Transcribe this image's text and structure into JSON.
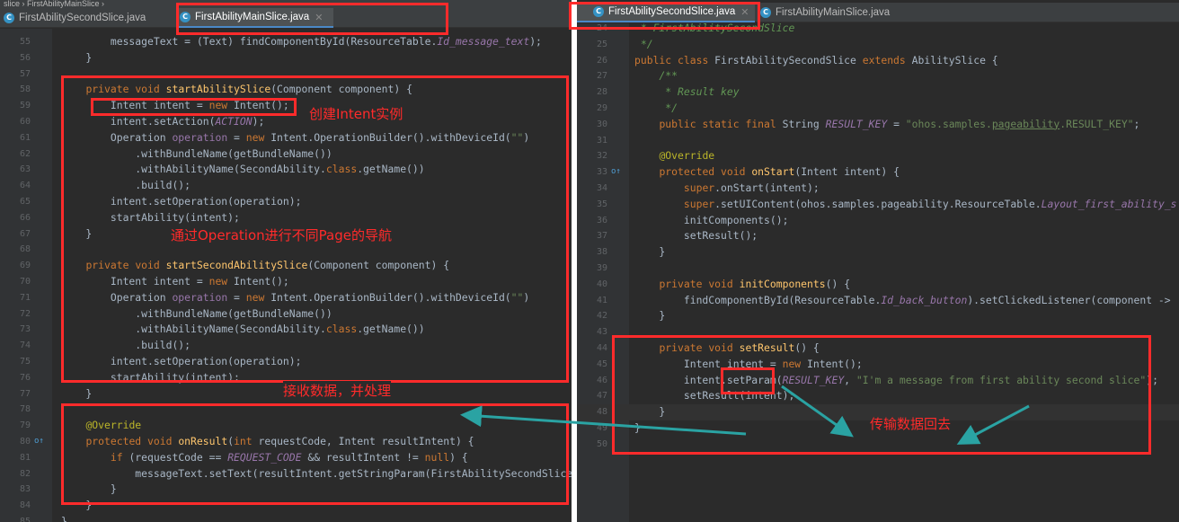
{
  "left_editor": {
    "breadcrumb": "slice › FirstAbilityMainSlice ›",
    "tabs": [
      {
        "label": "FirstAbilitySecondSlice.java",
        "icon": "C"
      },
      {
        "label": "FirstAbilityMainSlice.java",
        "icon": "C",
        "active": true
      }
    ],
    "lines": [
      {
        "n": "55",
        "code": "        messageText = (Text) findComponentById(ResourceTable.Id_message_text);"
      },
      {
        "n": "56",
        "code": "    }"
      },
      {
        "n": "57",
        "code": ""
      },
      {
        "n": "58",
        "code": "    private void startAbilitySlice(Component component) {"
      },
      {
        "n": "59",
        "code": "        Intent intent = new Intent();"
      },
      {
        "n": "60",
        "code": "        intent.setAction(ACTION);"
      },
      {
        "n": "61",
        "code": "        Operation operation = new Intent.OperationBuilder().withDeviceId(\"\")"
      },
      {
        "n": "62",
        "code": "            .withBundleName(getBundleName())"
      },
      {
        "n": "63",
        "code": "            .withAbilityName(SecondAbility.class.getName())"
      },
      {
        "n": "64",
        "code": "            .build();"
      },
      {
        "n": "65",
        "code": "        intent.setOperation(operation);"
      },
      {
        "n": "66",
        "code": "        startAbility(intent);"
      },
      {
        "n": "67",
        "code": "    }"
      },
      {
        "n": "68",
        "code": ""
      },
      {
        "n": "69",
        "code": "    private void startSecondAbilitySlice(Component component) {"
      },
      {
        "n": "70",
        "code": "        Intent intent = new Intent();"
      },
      {
        "n": "71",
        "code": "        Operation operation = new Intent.OperationBuilder().withDeviceId(\"\")"
      },
      {
        "n": "72",
        "code": "            .withBundleName(getBundleName())"
      },
      {
        "n": "73",
        "code": "            .withAbilityName(SecondAbility.class.getName())"
      },
      {
        "n": "74",
        "code": "            .build();"
      },
      {
        "n": "75",
        "code": "        intent.setOperation(operation);"
      },
      {
        "n": "76",
        "code": "        startAbility(intent);"
      },
      {
        "n": "77",
        "code": "    }"
      },
      {
        "n": "78",
        "code": ""
      },
      {
        "n": "79",
        "code": "    @Override"
      },
      {
        "n": "80",
        "code": "    protected void onResult(int requestCode, Intent resultIntent) {"
      },
      {
        "n": "81",
        "code": "        if (requestCode == REQUEST_CODE && resultIntent != null) {"
      },
      {
        "n": "82",
        "code": "            messageText.setText(resultIntent.getStringParam(FirstAbilitySecondSlice.RESULT_"
      },
      {
        "n": "83",
        "code": "        }"
      },
      {
        "n": "84",
        "code": "    }"
      },
      {
        "n": "85",
        "code": "}"
      }
    ]
  },
  "right_editor": {
    "tabs": [
      {
        "label": "FirstAbilitySecondSlice.java",
        "icon": "C",
        "active": true
      },
      {
        "label": "FirstAbilityMainSlice.java",
        "icon": "C"
      }
    ],
    "lines": [
      {
        "n": "24",
        "code": " * FirstAbilitySecondSlice"
      },
      {
        "n": "25",
        "code": " */"
      },
      {
        "n": "26",
        "code": "public class FirstAbilitySecondSlice extends AbilitySlice {"
      },
      {
        "n": "27",
        "code": "    /**"
      },
      {
        "n": "28",
        "code": "     * Result key"
      },
      {
        "n": "29",
        "code": "     */"
      },
      {
        "n": "30",
        "code": "    public static final String RESULT_KEY = \"ohos.samples.pageability.RESULT_KEY\";"
      },
      {
        "n": "31",
        "code": ""
      },
      {
        "n": "32",
        "code": "    @Override"
      },
      {
        "n": "33",
        "code": "    protected void onStart(Intent intent) {"
      },
      {
        "n": "34",
        "code": "        super.onStart(intent);"
      },
      {
        "n": "35",
        "code": "        super.setUIContent(ohos.samples.pageability.ResourceTable.Layout_first_ability_s"
      },
      {
        "n": "36",
        "code": "        initComponents();"
      },
      {
        "n": "37",
        "code": "        setResult();"
      },
      {
        "n": "38",
        "code": "    }"
      },
      {
        "n": "39",
        "code": ""
      },
      {
        "n": "40",
        "code": "    private void initComponents() {"
      },
      {
        "n": "41",
        "code": "        findComponentById(ResourceTable.Id_back_button).setClickedListener(component ->"
      },
      {
        "n": "42",
        "code": "    }"
      },
      {
        "n": "43",
        "code": ""
      },
      {
        "n": "44",
        "code": "    private void setResult() {"
      },
      {
        "n": "45",
        "code": "        Intent intent = new Intent();"
      },
      {
        "n": "46",
        "code": "        intent.setParam(RESULT_KEY, \"I'm a message from first ability second slice\");"
      },
      {
        "n": "47",
        "code": "        setResult(intent);"
      },
      {
        "n": "48",
        "code": "    }"
      },
      {
        "n": "49",
        "code": "}"
      },
      {
        "n": "50",
        "code": ""
      }
    ]
  },
  "annotations": {
    "create_intent": "创建Intent实例",
    "operation_nav": "通过Operation进行不同Page的导航",
    "receive_data": "接收数据，并处理",
    "send_back": "传输数据回去"
  },
  "colors": {
    "annotation_red": "#ff2b2b",
    "arrow_teal": "#2aa3a3",
    "editor_bg": "#2b2b2b",
    "keyword": "#cc7832",
    "string": "#6a8759"
  }
}
